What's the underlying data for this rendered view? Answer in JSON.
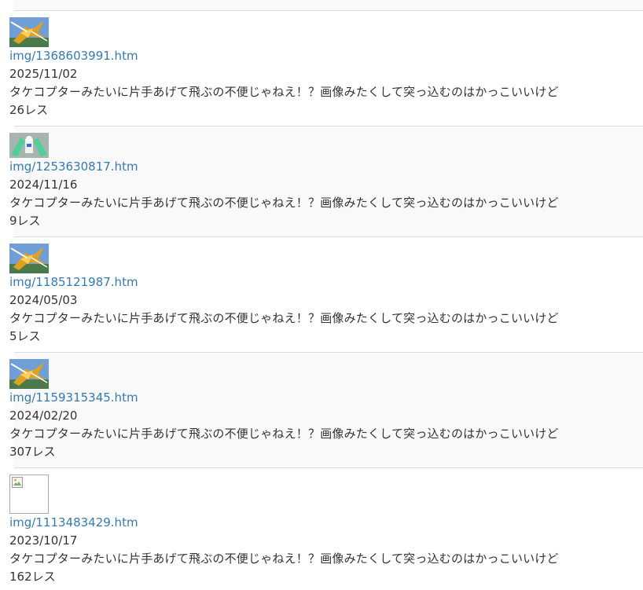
{
  "entries": [
    {
      "thumb": "mecha-yellow-icon",
      "link": "img/1368603991.htm",
      "date": "2025/11/02",
      "title": "タケコプターみたいに片手あげて飛ぶの不便じゃねえ！？画像みたくして突っ込むのはかっこいいけど",
      "replies": "26レス"
    },
    {
      "thumb": "mecha-white-icon",
      "link": "img/1253630817.htm",
      "date": "2024/11/16",
      "title": "タケコプターみたいに片手あげて飛ぶの不便じゃねえ！？画像みたくして突っ込むのはかっこいいけど",
      "replies": "9レス"
    },
    {
      "thumb": "mecha-yellow-icon",
      "link": "img/1185121987.htm",
      "date": "2024/05/03",
      "title": "タケコプターみたいに片手あげて飛ぶの不便じゃねえ！？画像みたくして突っ込むのはかっこいいけど",
      "replies": "5レス"
    },
    {
      "thumb": "mecha-yellow-icon",
      "link": "img/1159315345.htm",
      "date": "2024/02/20",
      "title": "タケコプターみたいに片手あげて飛ぶの不便じゃねえ！？画像みたくして突っ込むのはかっこいいけど",
      "replies": "307レス"
    },
    {
      "thumb": "broken-image-icon",
      "link": "img/1113483429.htm",
      "date": "2023/10/17",
      "title": "タケコプターみたいに片手あげて飛ぶの不便じゃねえ！？画像みたくして突っ込むのはかっこいいけど",
      "replies": "162レス"
    }
  ],
  "colors": {
    "link": "#337ab7",
    "text": "#333333",
    "alt_row": "#f9f9f9",
    "divider": "#dddddd"
  }
}
